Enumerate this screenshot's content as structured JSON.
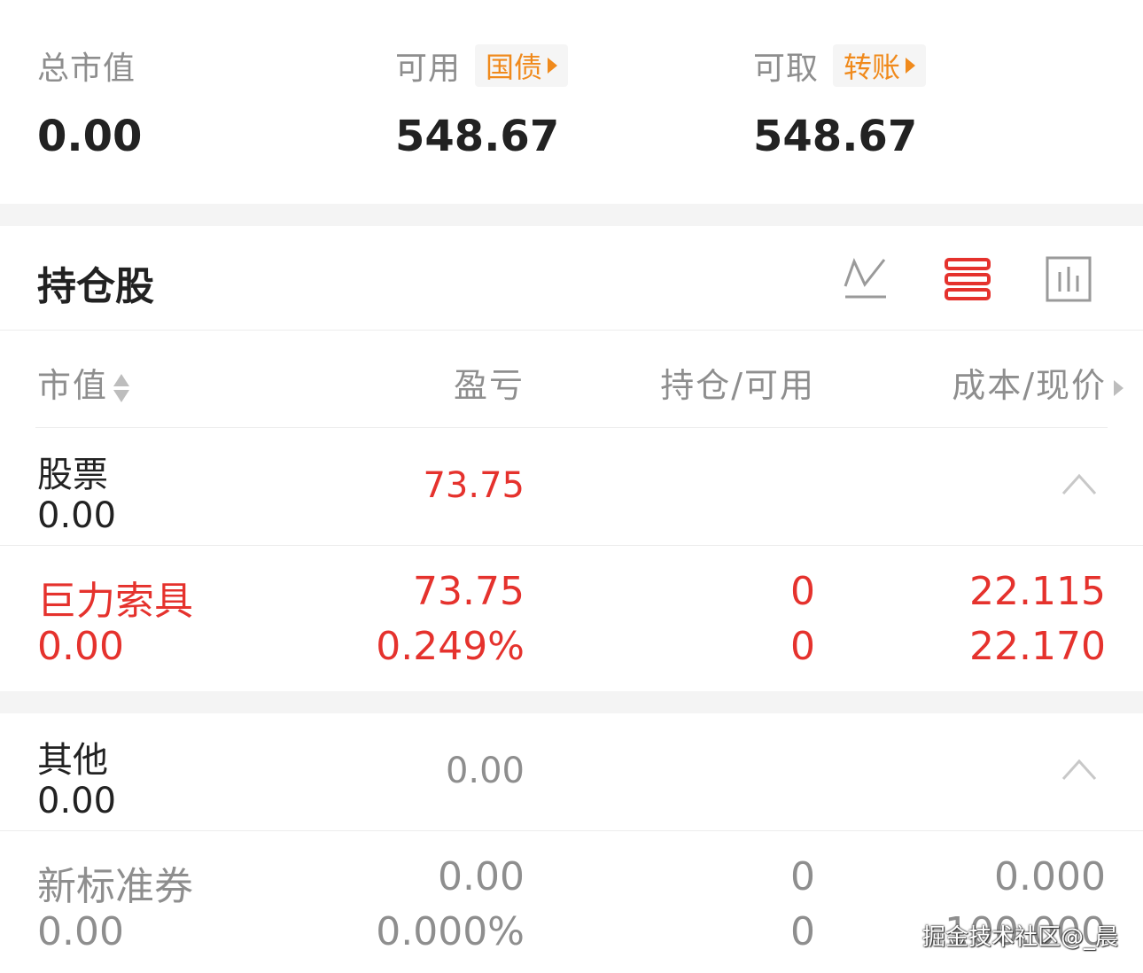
{
  "summary": {
    "total_market_value_label": "总市值",
    "total_market_value": "0.00",
    "available_label": "可用",
    "available_tag": "国债",
    "available_value": "548.67",
    "withdrawable_label": "可取",
    "withdrawable_tag": "转账",
    "withdrawable_value": "548.67"
  },
  "holdings": {
    "title": "持仓股",
    "view_icons": [
      "line-chart-icon",
      "list-view-icon",
      "bar-chart-icon"
    ],
    "active_view": "list-view-icon"
  },
  "columns": {
    "market_value": "市值",
    "profit_loss": "盈亏",
    "position_available": "持仓/可用",
    "cost_price": "成本/现价"
  },
  "groups": [
    {
      "name": "股票",
      "value": "0.00",
      "profit_loss": "73.75",
      "stocks": [
        {
          "name": "巨力索具",
          "market_value": "0.00",
          "profit_loss": "73.75",
          "profit_loss_pct": "0.249%",
          "position": "0",
          "available": "0",
          "cost": "22.115",
          "price": "22.170"
        }
      ]
    },
    {
      "name": "其他",
      "value": "0.00",
      "profit_loss": "0.00",
      "stocks": [
        {
          "name": "新标准券",
          "market_value": "0.00",
          "profit_loss": "0.00",
          "profit_loss_pct": "0.000%",
          "position": "0",
          "available": "0",
          "cost": "0.000",
          "price": "100.000"
        }
      ]
    }
  ],
  "watermark": "掘金技术社区@_晨",
  "colors": {
    "accent_red": "#e5322d",
    "tag_orange": "#f08a1c",
    "muted_gray": "#8e8e8e"
  }
}
